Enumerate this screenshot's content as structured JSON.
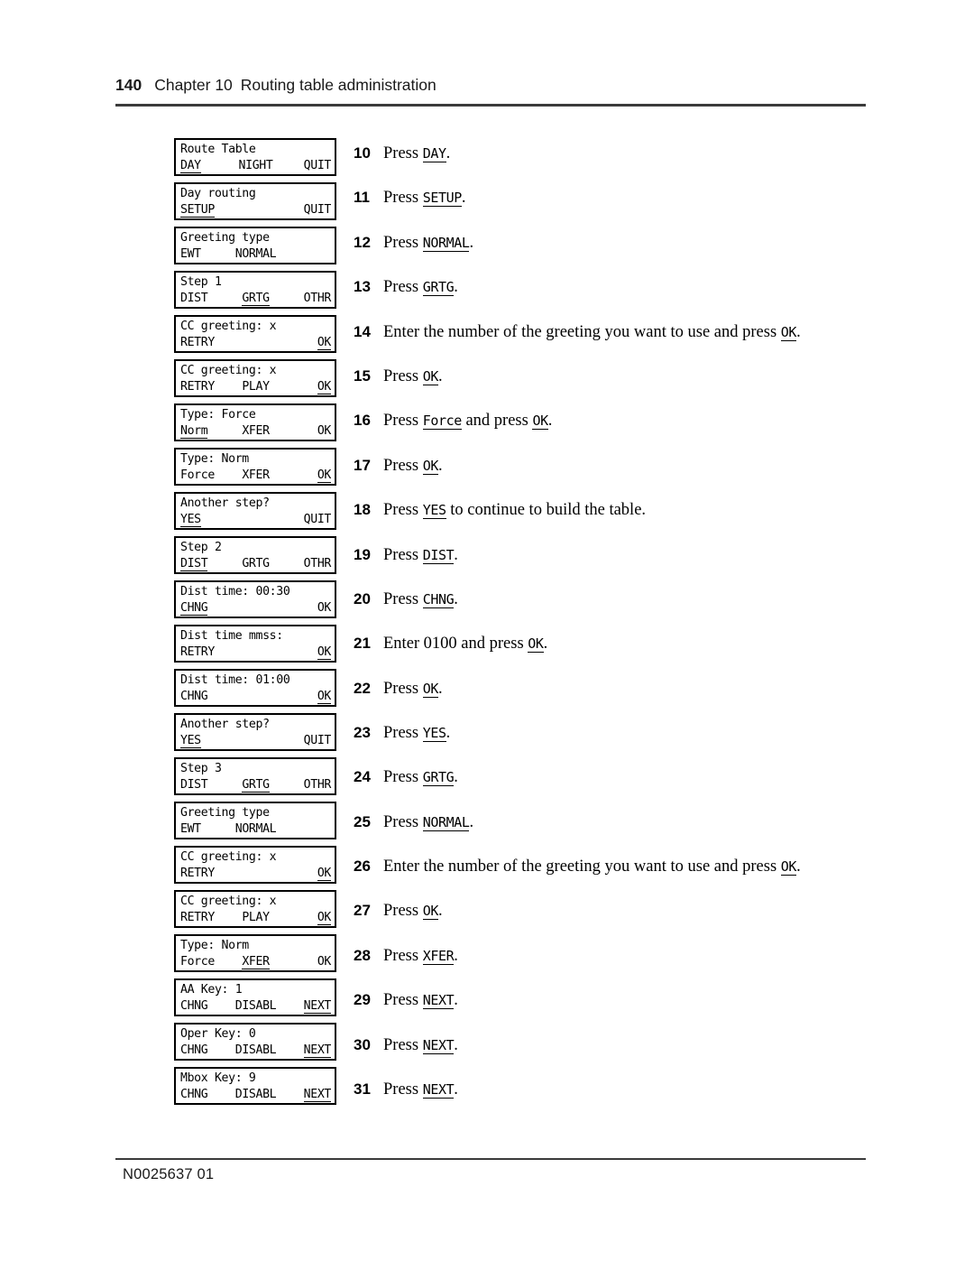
{
  "header": {
    "page_number": "140",
    "chapter": "Chapter 10",
    "title": "Routing table administration"
  },
  "footer": {
    "document_code": "N0025637 01"
  },
  "displays": [
    {
      "line1": "Route Table",
      "left": "DAY",
      "center": "NIGHT",
      "right": "QUIT",
      "underline": "left"
    },
    {
      "line1": "Day routing",
      "left": "SETUP",
      "center": "",
      "right": "QUIT",
      "underline": "left"
    },
    {
      "line1": "Greeting type",
      "left": "EWT",
      "center": "NORMAL",
      "right": "",
      "underline": "none"
    },
    {
      "line1": "Step 1",
      "left": "DIST",
      "center": "GRTG",
      "right": "OTHR",
      "underline": "center"
    },
    {
      "line1": "CC greeting: x",
      "left": "RETRY",
      "center": "",
      "right": "OK",
      "underline": "right"
    },
    {
      "line1": "CC greeting: x",
      "left": "RETRY",
      "center": "PLAY",
      "right": "OK",
      "underline": "right"
    },
    {
      "line1": "Type: Force",
      "left": "Norm",
      "center": "XFER",
      "right": "OK",
      "underline": "left"
    },
    {
      "line1": "Type: Norm",
      "left": "Force",
      "center": "XFER",
      "right": "OK",
      "underline": "right"
    },
    {
      "line1": "Another step?",
      "left": "YES",
      "center": "",
      "right": "QUIT",
      "underline": "left"
    },
    {
      "line1": "Step 2",
      "left": "DIST",
      "center": "GRTG",
      "right": "OTHR",
      "underline": "left"
    },
    {
      "line1": "Dist time: 00:30",
      "left": "CHNG",
      "center": "",
      "right": "OK",
      "underline": "left"
    },
    {
      "line1": "Dist time mmss:",
      "left": "RETRY",
      "center": "",
      "right": "OK",
      "underline": "right"
    },
    {
      "line1": "Dist time: 01:00",
      "left": "CHNG",
      "center": "",
      "right": "OK",
      "underline": "right"
    },
    {
      "line1": "Another step?",
      "left": "YES",
      "center": "",
      "right": "QUIT",
      "underline": "left"
    },
    {
      "line1": "Step 3",
      "left": "DIST",
      "center": "GRTG",
      "right": "OTHR",
      "underline": "center"
    },
    {
      "line1": "Greeting type",
      "left": "EWT",
      "center": "NORMAL",
      "right": "",
      "underline": "none"
    },
    {
      "line1": "CC greeting: x",
      "left": "RETRY",
      "center": "",
      "right": "OK",
      "underline": "right"
    },
    {
      "line1": "CC greeting: x",
      "left": "RETRY",
      "center": "PLAY",
      "right": "OK",
      "underline": "right"
    },
    {
      "line1": "Type: Norm",
      "left": "Force",
      "center": "XFER",
      "right": "OK",
      "underline": "center"
    },
    {
      "line1": "AA Key: 1",
      "left": "CHNG",
      "center": "DISABL",
      "right": "NEXT",
      "underline": "right"
    },
    {
      "line1": "Oper Key: 0",
      "left": "CHNG",
      "center": "DISABL",
      "right": "NEXT",
      "underline": "right"
    },
    {
      "line1": "Mbox Key: 9",
      "left": "CHNG",
      "center": "DISABL",
      "right": "NEXT",
      "underline": "right"
    }
  ],
  "steps": [
    {
      "num": "10",
      "parts": [
        {
          "t": "text",
          "v": "Press "
        },
        {
          "t": "key",
          "v": "DAY"
        },
        {
          "t": "text",
          "v": "."
        }
      ]
    },
    {
      "num": "11",
      "parts": [
        {
          "t": "text",
          "v": "Press  "
        },
        {
          "t": "key",
          "v": "SETUP"
        },
        {
          "t": "text",
          "v": "."
        }
      ]
    },
    {
      "num": "12",
      "parts": [
        {
          "t": "text",
          "v": "Press "
        },
        {
          "t": "key",
          "v": "NORMAL"
        },
        {
          "t": "text",
          "v": "."
        }
      ]
    },
    {
      "num": "13",
      "parts": [
        {
          "t": "text",
          "v": "Press "
        },
        {
          "t": "key",
          "v": "GRTG"
        },
        {
          "t": "text",
          "v": "."
        }
      ]
    },
    {
      "num": "14",
      "parts": [
        {
          "t": "text",
          "v": "Enter the number of the greeting you want to use and press "
        },
        {
          "t": "key",
          "v": "OK"
        },
        {
          "t": "text",
          "v": "."
        }
      ]
    },
    {
      "num": "15",
      "parts": [
        {
          "t": "text",
          "v": "Press "
        },
        {
          "t": "key",
          "v": "OK"
        },
        {
          "t": "text",
          "v": "."
        }
      ]
    },
    {
      "num": "16",
      "parts": [
        {
          "t": "text",
          "v": "Press "
        },
        {
          "t": "key",
          "v": "Force"
        },
        {
          "t": "text",
          "v": " and press "
        },
        {
          "t": "key",
          "v": "OK"
        },
        {
          "t": "text",
          "v": "."
        }
      ]
    },
    {
      "num": "17",
      "parts": [
        {
          "t": "text",
          "v": "Press "
        },
        {
          "t": "key",
          "v": "OK"
        },
        {
          "t": "text",
          "v": "."
        }
      ]
    },
    {
      "num": "18",
      "parts": [
        {
          "t": "text",
          "v": "Press "
        },
        {
          "t": "key",
          "v": "YES"
        },
        {
          "t": "text",
          "v": " to continue to build the table."
        }
      ]
    },
    {
      "num": "19",
      "parts": [
        {
          "t": "text",
          "v": "Press "
        },
        {
          "t": "key",
          "v": "DIST"
        },
        {
          "t": "text",
          "v": "."
        }
      ]
    },
    {
      "num": "20",
      "parts": [
        {
          "t": "text",
          "v": "Press "
        },
        {
          "t": "key",
          "v": "CHNG"
        },
        {
          "t": "text",
          "v": "."
        }
      ]
    },
    {
      "num": "21",
      "parts": [
        {
          "t": "text",
          "v": "Enter 0100 and press "
        },
        {
          "t": "key",
          "v": "OK"
        },
        {
          "t": "text",
          "v": "."
        }
      ]
    },
    {
      "num": "22",
      "parts": [
        {
          "t": "text",
          "v": "Press "
        },
        {
          "t": "key",
          "v": "OK"
        },
        {
          "t": "text",
          "v": "."
        }
      ]
    },
    {
      "num": "23",
      "parts": [
        {
          "t": "text",
          "v": "Press "
        },
        {
          "t": "key",
          "v": "YES"
        },
        {
          "t": "text",
          "v": "."
        }
      ]
    },
    {
      "num": "24",
      "parts": [
        {
          "t": "text",
          "v": "Press "
        },
        {
          "t": "key",
          "v": "GRTG"
        },
        {
          "t": "text",
          "v": "."
        }
      ]
    },
    {
      "num": "25",
      "parts": [
        {
          "t": "text",
          "v": "Press "
        },
        {
          "t": "key",
          "v": "NORMAL"
        },
        {
          "t": "text",
          "v": "."
        }
      ]
    },
    {
      "num": "26",
      "parts": [
        {
          "t": "text",
          "v": "Enter the number of the greeting you want to use and press "
        },
        {
          "t": "key",
          "v": "OK"
        },
        {
          "t": "text",
          "v": "."
        }
      ]
    },
    {
      "num": "27",
      "parts": [
        {
          "t": "text",
          "v": "Press "
        },
        {
          "t": "key",
          "v": "OK"
        },
        {
          "t": "text",
          "v": "."
        }
      ]
    },
    {
      "num": "28",
      "parts": [
        {
          "t": "text",
          "v": "Press "
        },
        {
          "t": "key",
          "v": "XFER"
        },
        {
          "t": "text",
          "v": "."
        }
      ]
    },
    {
      "num": "29",
      "parts": [
        {
          "t": "text",
          "v": "Press "
        },
        {
          "t": "key",
          "v": "NEXT"
        },
        {
          "t": "text",
          "v": "."
        }
      ]
    },
    {
      "num": "30",
      "parts": [
        {
          "t": "text",
          "v": "Press "
        },
        {
          "t": "key",
          "v": "NEXT"
        },
        {
          "t": "text",
          "v": "."
        }
      ]
    },
    {
      "num": "31",
      "parts": [
        {
          "t": "text",
          "v": "Press "
        },
        {
          "t": "key",
          "v": "NEXT"
        },
        {
          "t": "text",
          "v": "."
        }
      ]
    }
  ],
  "layout": {
    "display_top_start": 153,
    "display_pitch": 49,
    "step_tops": [
      159,
      208,
      258,
      307,
      357,
      406,
      455,
      505,
      554,
      604,
      653,
      702,
      752,
      801,
      850,
      900,
      949,
      998,
      1048,
      1097,
      1147,
      1196
    ]
  }
}
